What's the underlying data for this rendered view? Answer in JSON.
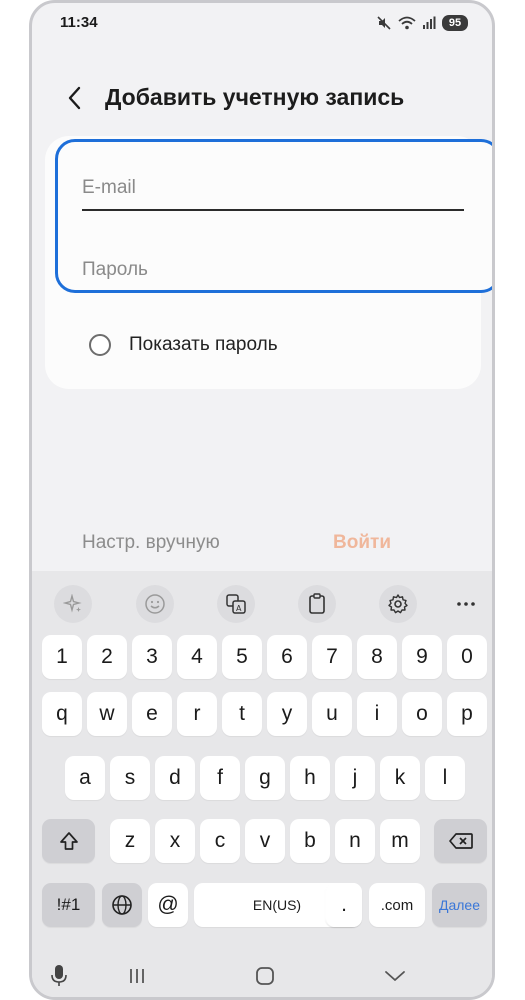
{
  "status": {
    "time": "11:34",
    "battery": "95",
    "icons": [
      "mute-icon",
      "wifi-icon",
      "signal-icon"
    ]
  },
  "header": {
    "back_icon": "chevron-left-icon",
    "title": "Добавить учетную запись"
  },
  "form": {
    "email_placeholder": "E-mail",
    "email_value": "",
    "password_placeholder": "Пароль",
    "password_value": "",
    "show_password_label": "Показать пароль"
  },
  "actions": {
    "manual_label": "Настр. вручную",
    "login_label": "Войти"
  },
  "keyboard": {
    "toolbar": [
      "sparkle-icon",
      "emoji-icon",
      "translate-icon",
      "clipboard-icon",
      "settings-icon",
      "more-icon"
    ],
    "row_numbers": [
      "1",
      "2",
      "3",
      "4",
      "5",
      "6",
      "7",
      "8",
      "9",
      "0"
    ],
    "row_top": [
      "q",
      "w",
      "e",
      "r",
      "t",
      "y",
      "u",
      "i",
      "o",
      "p"
    ],
    "row_middle": [
      "a",
      "s",
      "d",
      "f",
      "g",
      "h",
      "j",
      "k",
      "l"
    ],
    "row_bottom": [
      "z",
      "x",
      "c",
      "v",
      "b",
      "n",
      "m"
    ],
    "symbols_label": "!#1",
    "at_label": "@",
    "space_label": "EN(US)",
    "dot_label": ".",
    "com_label": ".com",
    "done_label": "Далее"
  },
  "colors": {
    "focus_border": "#1e6fd9",
    "login_disabled": "#f0b79b",
    "done_text": "#3a77d8"
  }
}
